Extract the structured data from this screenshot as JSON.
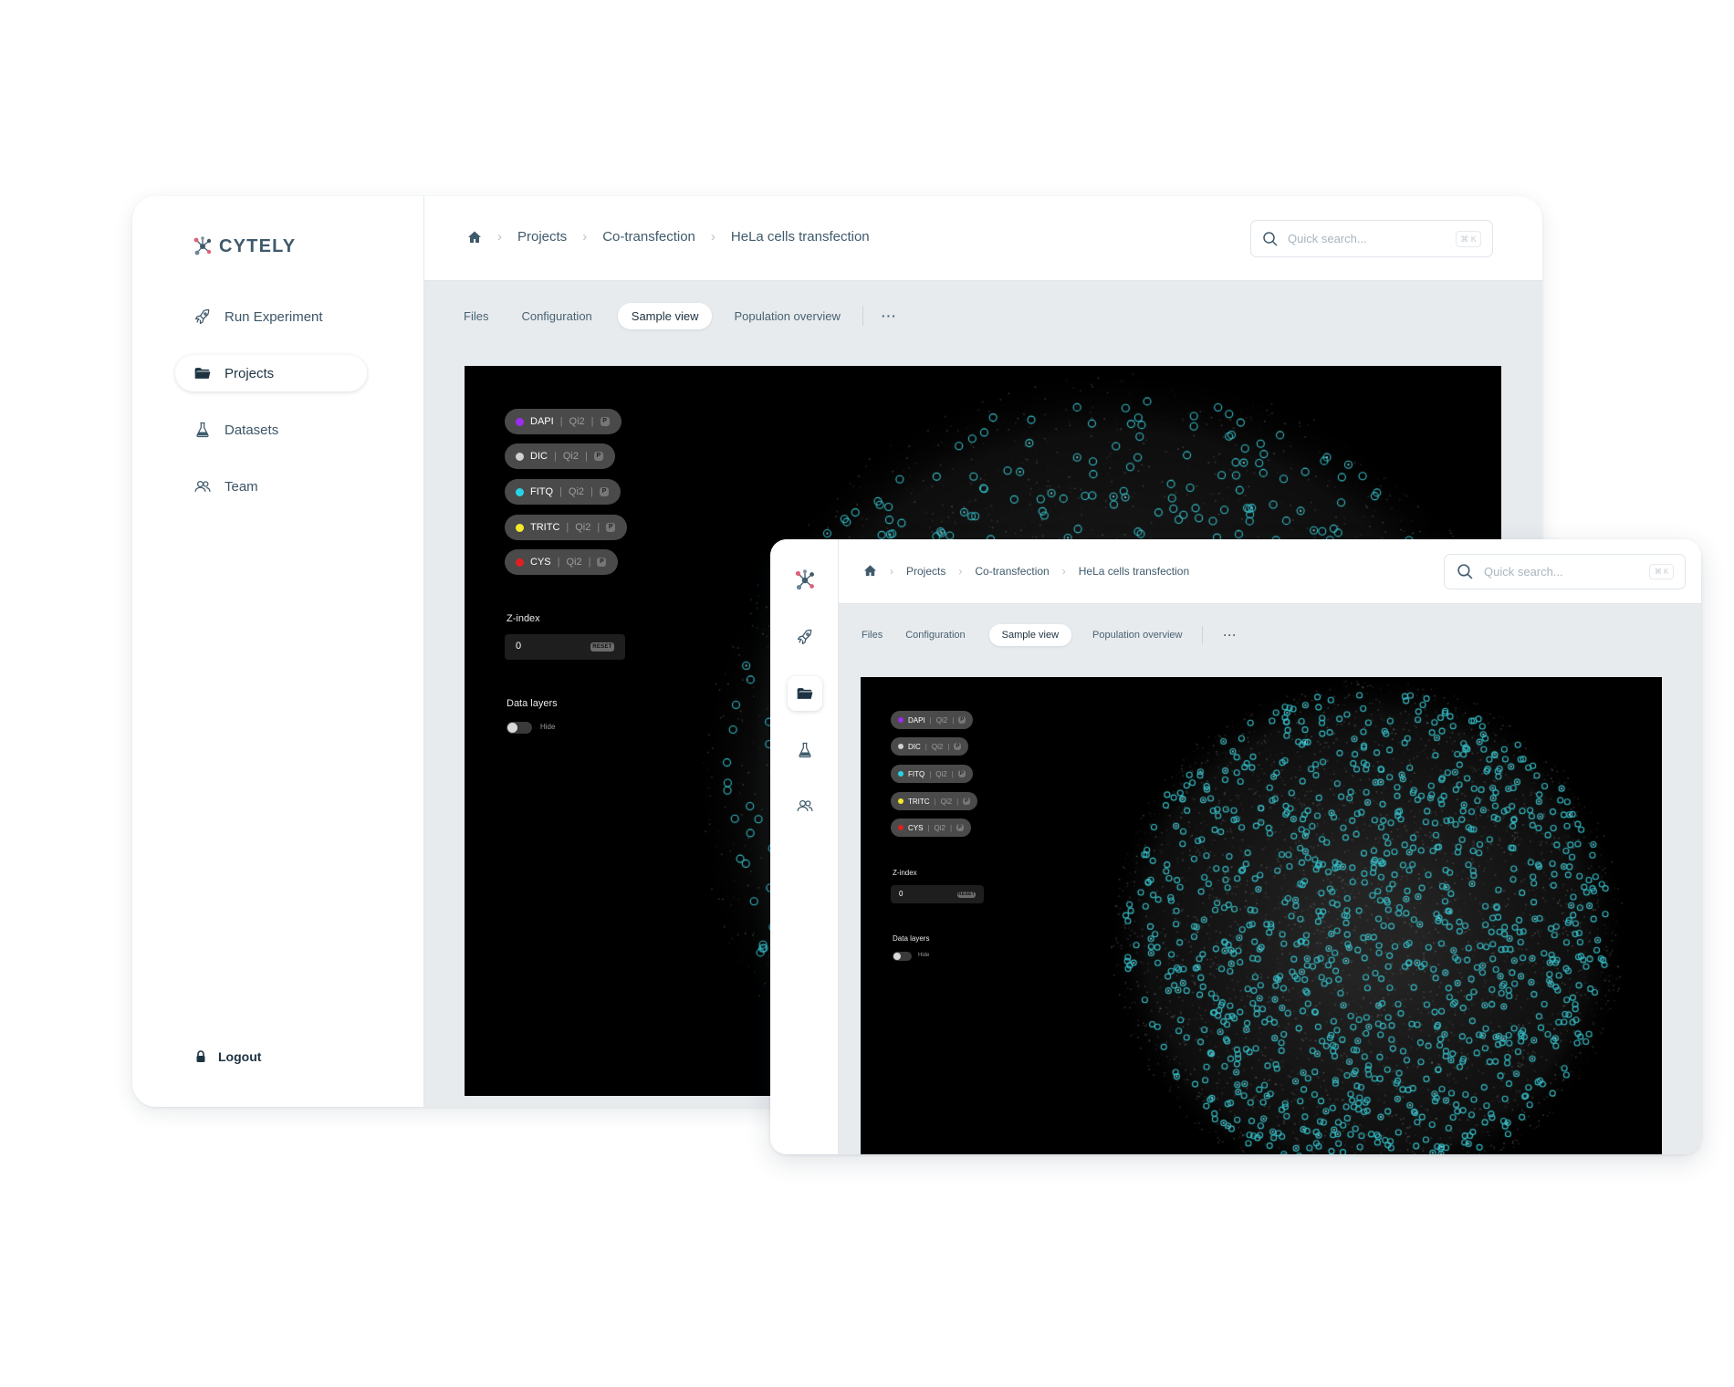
{
  "brand": {
    "name": "CYTELY"
  },
  "sidebar": {
    "items": [
      {
        "label": "Run Experiment",
        "icon": "rocket-icon"
      },
      {
        "label": "Projects",
        "icon": "folder-icon",
        "active": true
      },
      {
        "label": "Datasets",
        "icon": "flask-icon"
      },
      {
        "label": "Team",
        "icon": "users-icon"
      }
    ],
    "logout_label": "Logout"
  },
  "breadcrumb": [
    "Projects",
    "Co-transfection",
    "HeLa cells transfection"
  ],
  "search": {
    "placeholder": "Quick search...",
    "shortcut": "⌘ K"
  },
  "tabs": [
    {
      "label": "Files"
    },
    {
      "label": "Configuration"
    },
    {
      "label": "Sample view",
      "active": true
    },
    {
      "label": "Population overview"
    }
  ],
  "more_label": "···",
  "channels": [
    {
      "name": "DAPI",
      "meta": "Qi2",
      "btn": "P",
      "color": "#9b2cf0"
    },
    {
      "name": "DIC",
      "meta": "Qi2",
      "btn": "P",
      "color": "#d0d0d0"
    },
    {
      "name": "FITQ",
      "meta": "Qi2",
      "btn": "P",
      "color": "#29d3e6"
    },
    {
      "name": "TRITC",
      "meta": "Qi2",
      "btn": "P",
      "color": "#f2ea2a"
    },
    {
      "name": "CYS",
      "meta": "Qi2",
      "btn": "P",
      "color": "#e02020"
    }
  ],
  "zindex": {
    "label": "Z-index",
    "value": "0",
    "reset_label": "RESET"
  },
  "data_layers": {
    "label": "Data layers",
    "toggle_label": "Hide",
    "enabled": false
  },
  "colors": {
    "accent": "#2f4858",
    "marker": "#36c2cc",
    "viewer_bg": "#000000",
    "panel_bg": "#e7ebee"
  }
}
